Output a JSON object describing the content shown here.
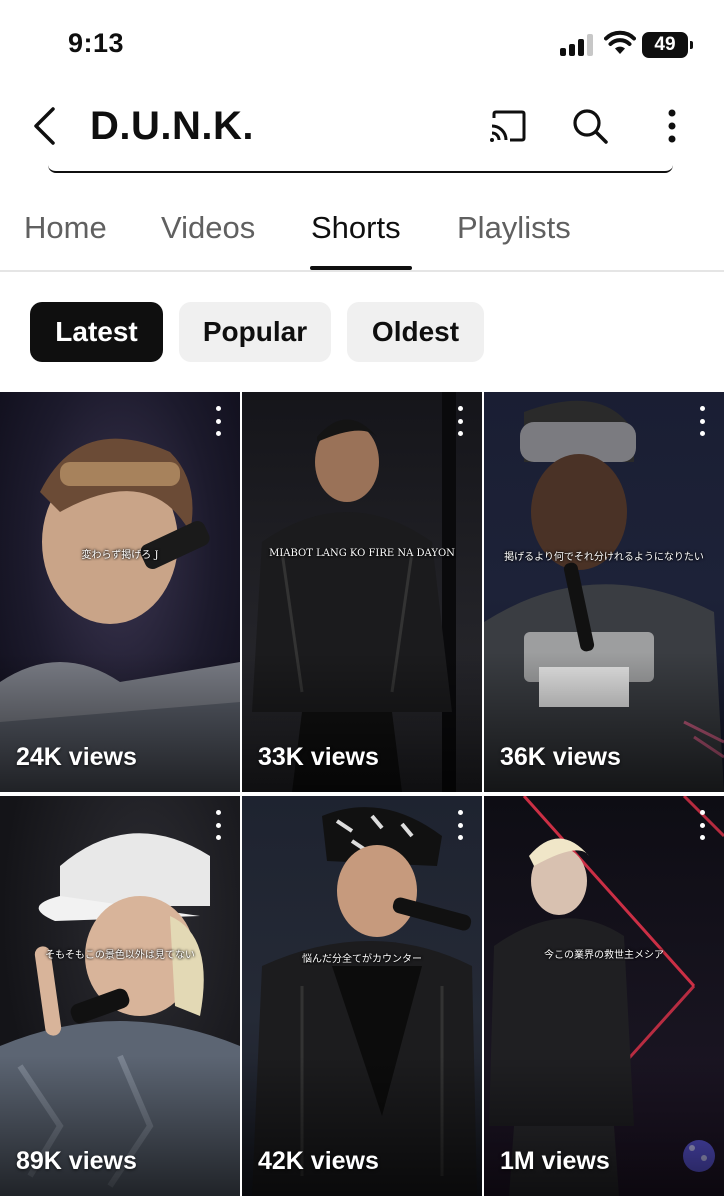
{
  "status_bar": {
    "time": "9:13",
    "battery": "49"
  },
  "header": {
    "title": "D.U.N.K.",
    "icons": [
      "back-arrow-icon",
      "cast-icon",
      "search-icon",
      "more-vert-icon"
    ]
  },
  "tabs": [
    {
      "label": "Home",
      "active": false
    },
    {
      "label": "Videos",
      "active": false
    },
    {
      "label": "Shorts",
      "active": true
    },
    {
      "label": "Playlists",
      "active": false
    }
  ],
  "chips": [
    {
      "label": "Latest",
      "active": true
    },
    {
      "label": "Popular",
      "active": false
    },
    {
      "label": "Oldest",
      "active": false
    }
  ],
  "shorts": [
    {
      "caption": "変わらず掲げろ J",
      "views": "24K views"
    },
    {
      "caption": "MIABOT LANG KO FIRE NA DAYON",
      "views": "33K views"
    },
    {
      "caption": "掲げるより何でそれ分けれるようになりたい",
      "views": "36K views"
    },
    {
      "caption": "そもそもこの景色以外は見てない",
      "views": "89K views"
    },
    {
      "caption": "悩んだ分全てがカウンター",
      "views": "42K views"
    },
    {
      "caption": "今この業界の救世主メシア",
      "views": "1M views"
    }
  ],
  "colors": {
    "text_primary": "#0f0f0f",
    "text_secondary": "#606060",
    "chip_bg": "#f0f0f0",
    "chip_active_bg": "#0f0f0f"
  }
}
